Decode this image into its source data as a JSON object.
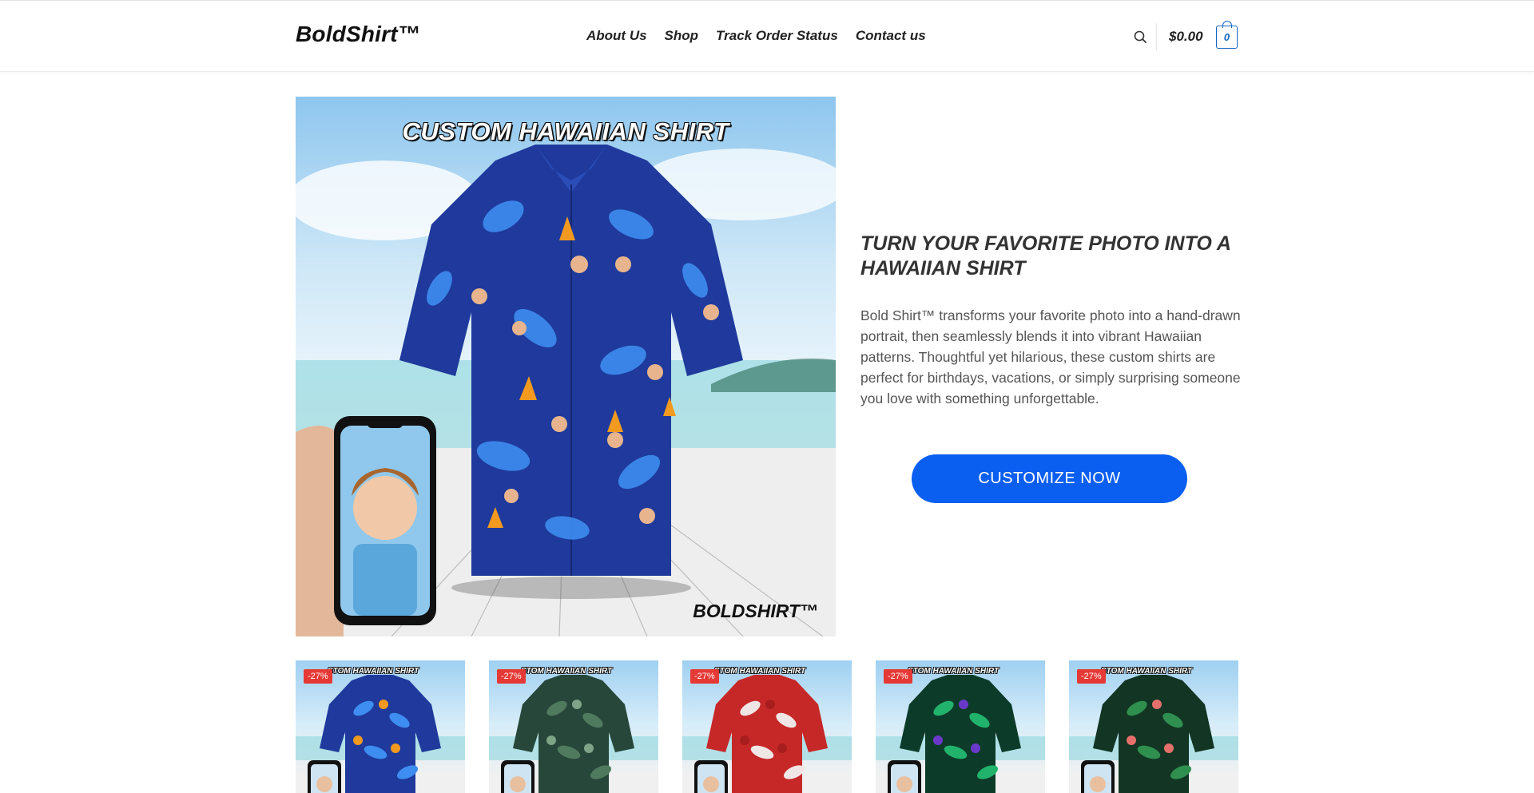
{
  "header": {
    "logo": "BoldShirt™",
    "nav": [
      "About Us",
      "Shop",
      "Track Order Status",
      "Contact us"
    ],
    "cart_total": "$0.00",
    "cart_count": "0"
  },
  "hero": {
    "image_caption": "CUSTOM HAWAIIAN SHIRT",
    "image_brand": "BOLDSHIRT™",
    "heading": "TURN YOUR FAVORITE PHOTO INTO A HAWAIIAN SHIRT",
    "description": "Bold Shirt™ transforms your favorite photo into a hand-drawn portrait, then seamlessly blends it into vibrant Hawaiian patterns. Thoughtful yet hilarious, these custom shirts are perfect for birthdays, vacations, or simply surprising someone you love with something unforgettable.",
    "cta": "CUSTOMIZE NOW"
  },
  "products": [
    {
      "sale": "-27%",
      "caption": "STOM HAWAIIAN SHIRT",
      "shirt_color": "#1f3a9c",
      "leaf_color": "#3e8df0",
      "accent_color": "#f29a1f"
    },
    {
      "sale": "-27%",
      "caption": "STOM HAWAIIAN SHIRT",
      "shirt_color": "#27473a",
      "leaf_color": "#4f7a5e",
      "accent_color": "#7ea386"
    },
    {
      "sale": "-27%",
      "caption": "STOM HAWAIIAN SHIRT",
      "shirt_color": "#c62828",
      "leaf_color": "#f1e6e6",
      "accent_color": "#a81d1d"
    },
    {
      "sale": "-27%",
      "caption": "STOM HAWAIIAN SHIRT",
      "shirt_color": "#0d3b2a",
      "leaf_color": "#21b36b",
      "accent_color": "#6b39c9"
    },
    {
      "sale": "-27%",
      "caption": "STOM HAWAIIAN SHIRT",
      "shirt_color": "#123524",
      "leaf_color": "#2f8f4e",
      "accent_color": "#e5706b"
    }
  ]
}
